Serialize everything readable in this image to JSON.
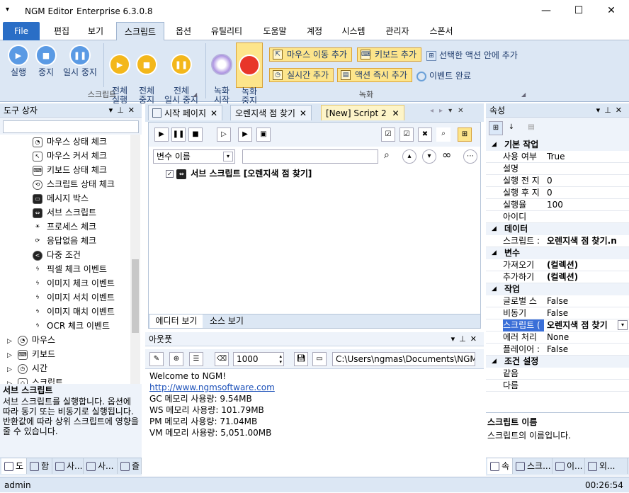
{
  "window": {
    "app_name": "NGM Editor",
    "edition": "Enterprise 6.3.0.8",
    "minimize": "—",
    "maximize": "☐",
    "close": "✕"
  },
  "menu": {
    "file": "File",
    "tabs": [
      "편집",
      "보기",
      "스크립트",
      "옵션",
      "유틸리티",
      "도움말",
      "계정",
      "시스템",
      "관리자",
      "스폰서"
    ],
    "active": "스크립트"
  },
  "ribbon": {
    "script_group_label": "스크립트",
    "record_group_label": "녹화",
    "run": "실행",
    "stop": "중지",
    "pause": "일시 중지",
    "run_all": "전체\n실행",
    "stop_all": "전체\n중지",
    "pause_all": "전체\n일시 중지",
    "record_start": "녹화\n시작",
    "record_stop": "녹화\n중지",
    "add_mouse_move": "마우스 이동 추가",
    "add_keyboard": "키보드 추가",
    "add_in_selected": "선택한 액션 안에 추가",
    "add_realtime": "실시간 추가",
    "add_action_now": "액션 즉시 추가",
    "event_complete": "이벤트 완료"
  },
  "toolbox": {
    "title": "도구 상자",
    "items": [
      "마우스 상태 체크",
      "마우스 커서 체크",
      "키보드 상태 체크",
      "스크립트 상태 체크",
      "메시지 박스",
      "서브 스크립트",
      "프로세스 체크",
      "응답없음 체크",
      "다중 조건",
      "픽셀 체크 이벤트",
      "이미지 체크 이벤트",
      "이미지 서치 이벤트",
      "이미지 매치 이벤트",
      "OCR 체크 이벤트"
    ],
    "groups": [
      "마우스",
      "키보드",
      "시간",
      "스크립트"
    ],
    "desc_title": "서브 스크립트",
    "desc_text": "서브 스크립트를 실행합니다. 옵션에 따라 동기 또는 비동기로 실행됩니다. 반환값에 따라 상위 스크립트에 영향을 줄 수 있습니다.",
    "bottom_tabs": [
      "도",
      "함",
      "사...",
      "사...",
      "즐"
    ]
  },
  "documents": {
    "tabs": [
      "시작 페이지",
      "오렌지색 점 찾기",
      "[New] Script 2"
    ],
    "active": 2,
    "variable_select": "변수 이름",
    "tree_root": "서브 스크립트 [오렌지색 점 찾기]",
    "view_tabs": [
      "에디터 보기",
      "소스 보기"
    ]
  },
  "output": {
    "title": "아웃풋",
    "count": "1000",
    "path": "C:\\Users\\ngmas\\Documents\\NGM6\\",
    "lines": [
      "Welcome to NGM!",
      "http://www.ngmsoftware.com",
      "GC 메모리 사용량: 9.54MB",
      "WS 메모리 사용량: 101.79MB",
      "PM 메모리 사용량: 71.04MB",
      "VM 메모리 사용량: 5,051.00MB"
    ]
  },
  "properties": {
    "title": "속성",
    "rows": [
      {
        "cat": "기본 작업"
      },
      {
        "k": "사용 여부",
        "v": "True"
      },
      {
        "k": "설명",
        "v": ""
      },
      {
        "k": "실행 전 지",
        "v": "0"
      },
      {
        "k": "실행 후 지",
        "v": "0"
      },
      {
        "k": "실행율",
        "v": "100"
      },
      {
        "k": "아이디",
        "v": ""
      },
      {
        "cat": "데이터"
      },
      {
        "k": "스크립트 :",
        "v": "오렌지색 점 찾기.n",
        "bold": true
      },
      {
        "cat": "변수"
      },
      {
        "k": "가져오기",
        "v": "(컬렉션)",
        "bold": true
      },
      {
        "k": "추가하기",
        "v": "(컬렉션)",
        "bold": true
      },
      {
        "cat": "작업"
      },
      {
        "k": "글로벌 스",
        "v": "False"
      },
      {
        "k": "비동기",
        "v": "False"
      },
      {
        "k": "스크립트 (",
        "v": "오렌지색 점 찾기",
        "bold": true,
        "selected": true
      },
      {
        "k": "에러 처리",
        "v": "None"
      },
      {
        "k": "플레이어 :",
        "v": "False"
      },
      {
        "cat": "조건 설정"
      },
      {
        "k": "같음",
        "v": ""
      },
      {
        "k": "다름",
        "v": ""
      }
    ],
    "desc_title": "스크립트 이름",
    "desc_text": "스크립트의 이름입니다.",
    "bottom_tabs": [
      "속",
      "스크...",
      "이...",
      "외..."
    ]
  },
  "status": {
    "user": "admin",
    "time": "00:26:54"
  }
}
